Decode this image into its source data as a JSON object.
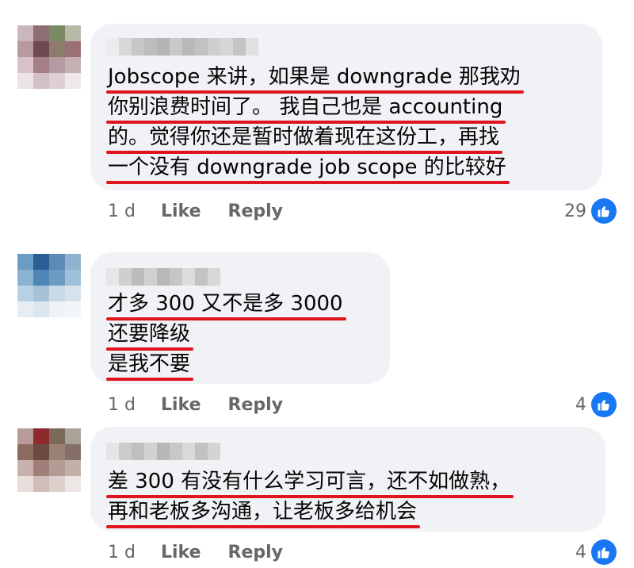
{
  "colors": {
    "accent": "#1877f2",
    "underline": "#e0141e",
    "bubble": "#f0f2f5",
    "meta": "#65676b"
  },
  "comments": [
    {
      "lines": [
        "Jobscope 来讲，如果是 downgrade 那我劝",
        "你别浪费时间了。 我自己也是 accounting",
        "的。觉得你还是暂时做着现在这份工，再找",
        "一个没有 downgrade job scope 的比较好"
      ],
      "time": "1 d",
      "like": "Like",
      "reply": "Reply",
      "reactions": "29",
      "reaction_icon": "like-icon"
    },
    {
      "lines": [
        "才多 300 又不是多 3000",
        "还要降级",
        "是我不要"
      ],
      "time": "1 d",
      "like": "Like",
      "reply": "Reply",
      "reactions": "4",
      "reaction_icon": "like-icon"
    },
    {
      "lines": [
        "差 300 有没有什么学习可言，还不如做熟，",
        "再和老板多沟通，让老板多给机会"
      ],
      "time": "1 d",
      "like": "Like",
      "reply": "Reply",
      "reactions": "4",
      "reaction_icon": "like-icon"
    }
  ]
}
